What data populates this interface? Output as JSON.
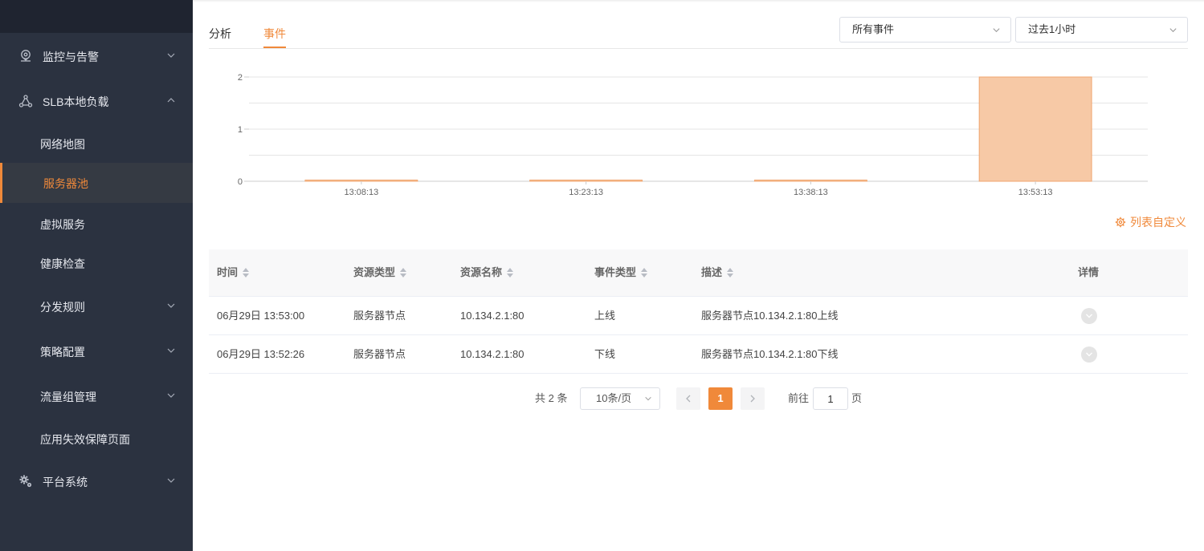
{
  "sidebar": {
    "items": [
      {
        "label": "监控与告警"
      },
      {
        "label": "SLB本地负载"
      },
      {
        "label": "网络地图"
      },
      {
        "label": "服务器池"
      },
      {
        "label": "虚拟服务"
      },
      {
        "label": "健康检查"
      },
      {
        "label": "分发规则"
      },
      {
        "label": "策略配置"
      },
      {
        "label": "流量组管理"
      },
      {
        "label": "应用失效保障页面"
      },
      {
        "label": "平台系统"
      }
    ],
    "active_item": "服务器池",
    "accent_color": "#f0893a",
    "background_color": "#2b3240"
  },
  "tabs": [
    {
      "label": "分析",
      "active": false
    },
    {
      "label": "事件",
      "active": true
    }
  ],
  "filters": {
    "event_type": {
      "value": "所有事件"
    },
    "time_range": {
      "value": "过去1小时"
    }
  },
  "chart_data": {
    "type": "bar",
    "categories": [
      "13:08:13",
      "13:23:13",
      "13:38:13",
      "13:53:13"
    ],
    "values": [
      0,
      0,
      0,
      2
    ],
    "ylim": [
      0,
      2
    ],
    "yticks": [
      "0",
      "1",
      "2"
    ],
    "bar_color": "#f7c9a6",
    "bar_edge_color": "#f0a56e",
    "grid": true
  },
  "customize_label": "列表自定义",
  "table": {
    "columns": [
      "时间",
      "资源类型",
      "资源名称",
      "事件类型",
      "描述",
      "详情"
    ],
    "rows": [
      [
        "06月29日 13:53:00",
        "服务器节点",
        "10.134.2.1:80",
        "上线",
        "服务器节点10.134.2.1:80上线"
      ],
      [
        "06月29日 13:52:26",
        "服务器节点",
        "10.134.2.1:80",
        "下线",
        "服务器节点10.134.2.1:80下线"
      ]
    ]
  },
  "pagination": {
    "total_text": "共 2 条",
    "page_size": "10条/页",
    "current_page": "1",
    "goto_label": "前往",
    "goto_value": "1",
    "page_suffix": "页"
  }
}
